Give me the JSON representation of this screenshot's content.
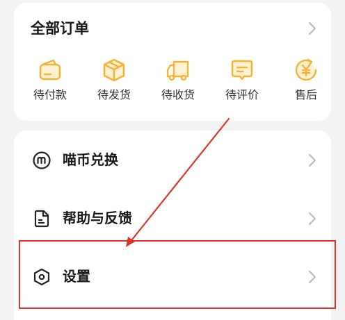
{
  "orders": {
    "title": "全部订单",
    "items": [
      {
        "label": "待付款",
        "icon": "wallet-icon"
      },
      {
        "label": "待发货",
        "icon": "package-icon"
      },
      {
        "label": "待收货",
        "icon": "truck-icon"
      },
      {
        "label": "待评价",
        "icon": "comment-icon"
      },
      {
        "label": "售后",
        "icon": "yen-refund-icon"
      }
    ]
  },
  "menu": {
    "items": [
      {
        "label": "喵币兑换",
        "icon": "meow-coin-icon"
      },
      {
        "label": "帮助与反馈",
        "icon": "document-icon"
      },
      {
        "label": "设置",
        "icon": "hexagon-settings-icon"
      }
    ]
  },
  "colors": {
    "accent": "#f5b335",
    "highlight": "#e0312b",
    "background": "#f2f2f2"
  }
}
